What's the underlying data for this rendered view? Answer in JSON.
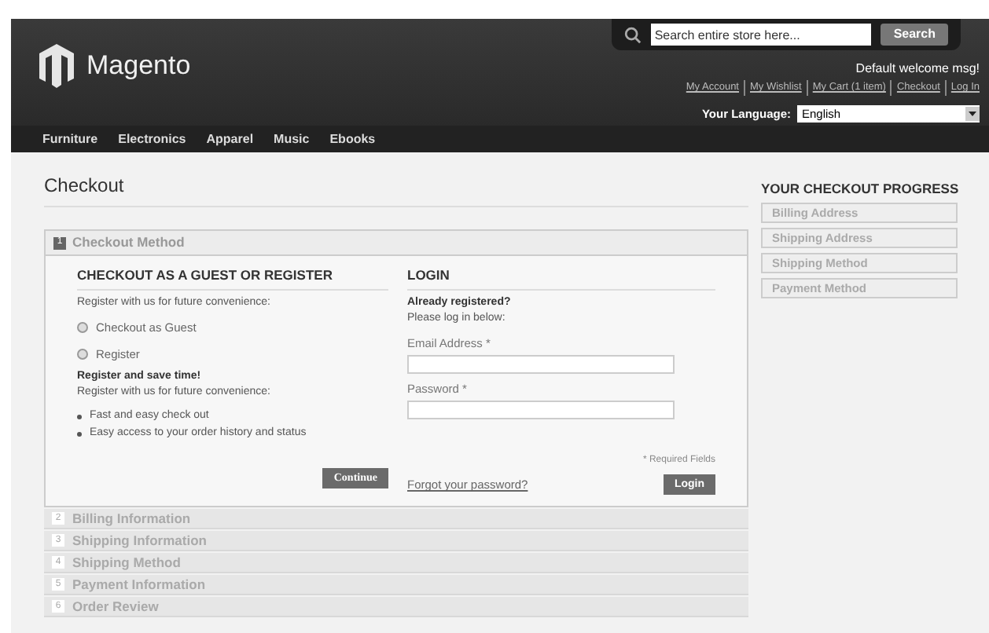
{
  "header": {
    "logo": "Magento",
    "search": {
      "placeholder": "Search entire store here...",
      "button": "Search"
    },
    "welcome": "Default welcome msg!",
    "links": [
      "My Account",
      "My Wishlist",
      "My Cart (1 item)",
      "Checkout",
      "Log In"
    ],
    "language": {
      "label": "Your Language:",
      "value": "English"
    }
  },
  "nav": [
    "Furniture",
    "Electronics",
    "Apparel",
    "Music",
    "Ebooks"
  ],
  "page_title": "Checkout",
  "steps": [
    {
      "number": "1",
      "title": "Checkout Method",
      "expanded": true
    },
    {
      "number": "2",
      "title": "Billing Information",
      "expanded": false
    },
    {
      "number": "3",
      "title": "Shipping Information",
      "expanded": false
    },
    {
      "number": "4",
      "title": "Shipping Method",
      "expanded": false
    },
    {
      "number": "5",
      "title": "Payment Information",
      "expanded": false
    },
    {
      "number": "6",
      "title": "Order Review",
      "expanded": false
    }
  ],
  "guest": {
    "heading": "CHECKOUT AS A GUEST OR REGISTER",
    "intro": "Register with us for future convenience:",
    "options": [
      {
        "label": "Checkout as Guest",
        "selected": false
      },
      {
        "label": "Register",
        "selected": false
      }
    ],
    "save_heading": "Register and save time!",
    "save_text": "Register with us for future convenience:",
    "benefits": [
      "Fast and easy check out",
      "Easy access to your order history and status"
    ],
    "button": "Continue"
  },
  "login": {
    "heading": "LOGIN",
    "subheading": "Already registered?",
    "text": "Please log in below:",
    "fields": [
      {
        "label": "Email Address *"
      },
      {
        "label": "Password *"
      }
    ],
    "required_note": "* Required Fields",
    "forgot_link": "Forgot your password?",
    "button": "Login"
  },
  "progress": {
    "title": "YOUR CHECKOUT PROGRESS",
    "items": [
      "Billing Address",
      "Shipping Address",
      "Shipping Method",
      "Payment Method"
    ]
  }
}
